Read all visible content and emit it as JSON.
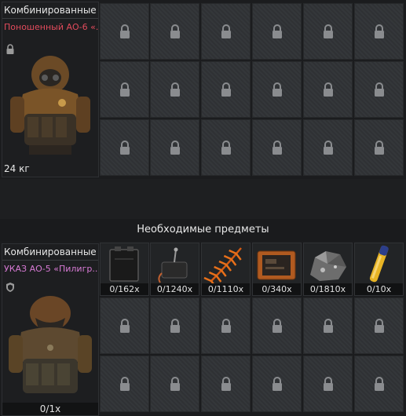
{
  "top_item": {
    "category": "Комбинированные",
    "name": "Поношенный АО-6 «..",
    "weight": "24 кг",
    "badge_icon": "lock-icon",
    "name_color": "#e24b5c"
  },
  "required_section": {
    "title": "Необходимые предметы"
  },
  "bottom_item": {
    "category": "Комбинированные",
    "name": "УКАЗ АО-5 «Пилигр..",
    "quantity": "0/1x",
    "badge_icon": "shield-icon",
    "name_color": "#d77ad4"
  },
  "required_items": [
    {
      "icon": "battery-icon",
      "count": "0/162x"
    },
    {
      "icon": "switch-icon",
      "count": "0/1240x"
    },
    {
      "icon": "fern-icon",
      "count": "0/1110x"
    },
    {
      "icon": "tablet-icon",
      "count": "0/340x"
    },
    {
      "icon": "ore-icon",
      "count": "0/1810x"
    },
    {
      "icon": "vial-icon",
      "count": "0/10x"
    }
  ],
  "slot_icon": "lock-icon"
}
